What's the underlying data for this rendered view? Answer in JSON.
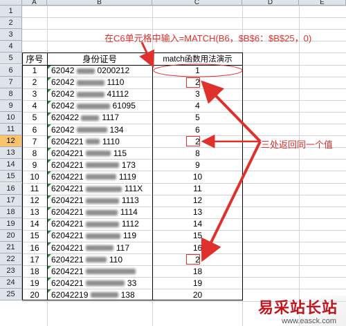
{
  "columns": [
    "A",
    "B",
    "C",
    "D",
    "E"
  ],
  "rows": [
    "1",
    "2",
    "3",
    "4",
    "5",
    "6",
    "7",
    "8",
    "9",
    "10",
    "11",
    "12",
    "13",
    "14",
    "15",
    "16",
    "17",
    "18",
    "19",
    "20",
    "21",
    "22",
    "23",
    "24",
    "25"
  ],
  "selected_row": "12",
  "header_row": {
    "seq": "序号",
    "id": "身份证号",
    "match": "match函数用法演示"
  },
  "data_rows": [
    {
      "seq": "1",
      "id": "62042",
      "id_tail": "0200212",
      "val": "1"
    },
    {
      "seq": "2",
      "id": "62042",
      "id_tail": "1110",
      "val": "2"
    },
    {
      "seq": "3",
      "id": "62042",
      "id_tail": "41112",
      "val": "3"
    },
    {
      "seq": "4",
      "id": "62042",
      "id_tail": "61095",
      "val": "4"
    },
    {
      "seq": "5",
      "id": "620422",
      "id_tail": "1117",
      "val": "5"
    },
    {
      "seq": "6",
      "id": "62042",
      "id_tail": "134",
      "val": "6"
    },
    {
      "seq": "7",
      "id": "6204221",
      "id_tail": "1110",
      "val": "2"
    },
    {
      "seq": "8",
      "id": "6204221",
      "id_tail": "115",
      "val": "8"
    },
    {
      "seq": "9",
      "id": "6204221",
      "id_tail": "173",
      "val": "9"
    },
    {
      "seq": "10",
      "id": "6204221",
      "id_tail": "1119",
      "val": "10"
    },
    {
      "seq": "11",
      "id": "6204221",
      "id_tail": "111X",
      "val": "11"
    },
    {
      "seq": "12",
      "id": "6204221",
      "id_tail": "1113",
      "val": "12"
    },
    {
      "seq": "13",
      "id": "6204221",
      "id_tail": "1114",
      "val": "13"
    },
    {
      "seq": "14",
      "id": "6204221",
      "id_tail": "1112",
      "val": "14"
    },
    {
      "seq": "15",
      "id": "6204221",
      "id_tail": "119",
      "val": "15"
    },
    {
      "seq": "16",
      "id": "6204221",
      "id_tail": "117",
      "val": "16"
    },
    {
      "seq": "17",
      "id": "6204221",
      "id_tail": "110",
      "val": "2"
    },
    {
      "seq": "18",
      "id": "6204221",
      "id_tail": "",
      "val": "18"
    },
    {
      "seq": "19",
      "id": "6204221",
      "id_tail": "33",
      "val": "19"
    },
    {
      "seq": "20",
      "id": "62042219",
      "id_tail": "138",
      "val": "20"
    }
  ],
  "annotations": {
    "formula": "在C6单元格中输入=MATCH(B6，$B$6：$B$25，0)",
    "same_value": "三处返回同一个值"
  },
  "watermark": {
    "title": "易采站长站",
    "url": "www.easck.com"
  },
  "colors": {
    "annotation": "#e0302c",
    "header_bg": "#dfe3ea",
    "selected_header": "#f7c46b"
  }
}
